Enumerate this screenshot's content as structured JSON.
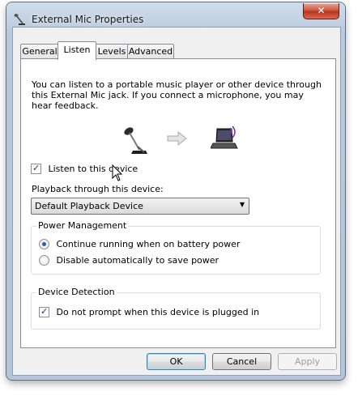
{
  "window": {
    "title": "External Mic Properties",
    "close_label": "✕"
  },
  "tabs": [
    {
      "label": "General"
    },
    {
      "label": "Listen",
      "active": true
    },
    {
      "label": "Levels"
    },
    {
      "label": "Advanced"
    }
  ],
  "listen": {
    "description": "You can listen to a portable music player or other device through this External Mic jack.  If you connect a microphone, you may hear feedback.",
    "listen_checkbox_label": "Listen to this device",
    "listen_checked": true,
    "playback_label": "Playback through this device:",
    "playback_selected": "Default Playback Device",
    "source_icon": "microphone-icon",
    "arrow_icon": "arrow-right-icon",
    "target_icon": "laptop-speaker-icon"
  },
  "power": {
    "title": "Power Management",
    "option1": "Continue running when on battery power",
    "option2": "Disable automatically to save power",
    "selected": 1
  },
  "detection": {
    "title": "Device Detection",
    "checkbox_label": "Do not prompt when this device is plugged in",
    "checked": true
  },
  "buttons": {
    "ok": "OK",
    "cancel": "Cancel",
    "apply": "Apply"
  },
  "colors": {
    "accent": "#3c7fb1",
    "radio_dot": "#2b5ea8",
    "close": "#c4432c"
  }
}
